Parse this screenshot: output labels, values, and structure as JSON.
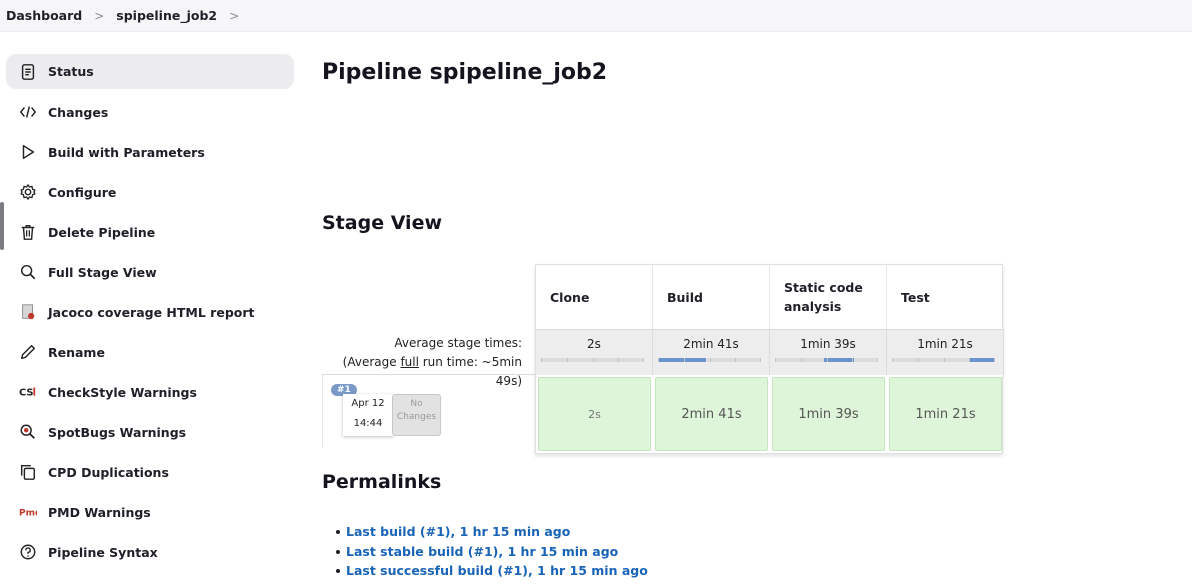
{
  "breadcrumb": {
    "items": [
      "Dashboard",
      "spipeline_job2"
    ]
  },
  "sidebar": {
    "items": [
      {
        "label": "Status",
        "icon": "status-icon"
      },
      {
        "label": "Changes",
        "icon": "code-icon"
      },
      {
        "label": "Build with Parameters",
        "icon": "play-icon"
      },
      {
        "label": "Configure",
        "icon": "gear-icon"
      },
      {
        "label": "Delete Pipeline",
        "icon": "trash-icon"
      },
      {
        "label": "Full Stage View",
        "icon": "search-icon"
      },
      {
        "label": "Jacoco coverage HTML report",
        "icon": "jacoco-icon"
      },
      {
        "label": "Rename",
        "icon": "pencil-icon"
      },
      {
        "label": "CheckStyle Warnings",
        "icon": "checkstyle-icon"
      },
      {
        "label": "SpotBugs Warnings",
        "icon": "spotbugs-icon"
      },
      {
        "label": "CPD Duplications",
        "icon": "copy-icon"
      },
      {
        "label": "PMD Warnings",
        "icon": "pmd-icon"
      },
      {
        "label": "Pipeline Syntax",
        "icon": "help-icon"
      }
    ]
  },
  "main": {
    "title": "Pipeline spipeline_job2",
    "stage_view_heading": "Stage View",
    "avg_label_line1": "Average stage times:",
    "avg_label_line2a": "(Average ",
    "avg_label_full": "full",
    "avg_label_line2b": " run time: ~5min",
    "avg_label_line3": "49s)",
    "run": {
      "badge": "#1",
      "date": "Apr 12",
      "time": "14:44",
      "changes_line1": "No",
      "changes_line2": "Changes"
    },
    "stages": [
      {
        "name": "Clone",
        "avg": "2s",
        "cell": "2s",
        "bar_fraction": 0.0
      },
      {
        "name": "Build",
        "avg": "2min 41s",
        "cell": "2min 41s",
        "bar_fraction": 0.47
      },
      {
        "name": "Static code analysis",
        "avg": "1min 39s",
        "cell": "1min 39s",
        "bar_fraction": 0.29
      },
      {
        "name": "Test",
        "avg": "1min 21s",
        "cell": "1min 21s",
        "bar_fraction": 0.24
      }
    ],
    "permalinks_heading": "Permalinks",
    "permalinks": [
      "Last build (#1), 1 hr 15 min ago",
      "Last stable build (#1), 1 hr 15 min ago",
      "Last successful build (#1), 1 hr 15 min ago"
    ]
  },
  "colors": {
    "accent_link": "#1a64b7",
    "stage_success": "#dff5d9",
    "progress": "#6d93cf"
  }
}
